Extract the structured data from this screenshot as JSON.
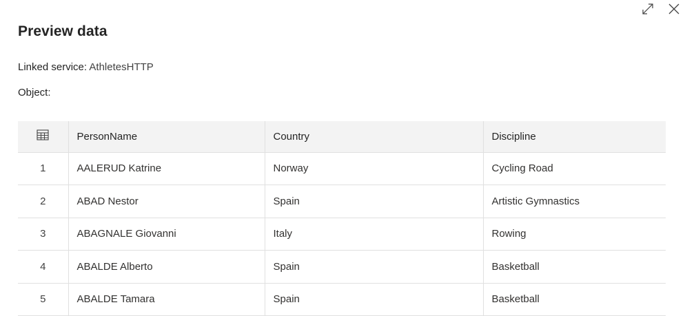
{
  "dialog": {
    "title": "Preview data",
    "linked_service_label": "Linked service:",
    "linked_service_value": "AthletesHTTP",
    "object_label": "Object:",
    "object_value": ""
  },
  "icons": {
    "expand": "expand-icon",
    "close": "close-icon",
    "grid": "table-grid-icon"
  },
  "table": {
    "columns": [
      "PersonName",
      "Country",
      "Discipline"
    ],
    "rows": [
      {
        "index": "1",
        "person": "AALERUD Katrine",
        "country": "Norway",
        "discipline": "Cycling Road"
      },
      {
        "index": "2",
        "person": "ABAD Nestor",
        "country": "Spain",
        "discipline": "Artistic Gymnastics"
      },
      {
        "index": "3",
        "person": "ABAGNALE Giovanni",
        "country": "Italy",
        "discipline": "Rowing"
      },
      {
        "index": "4",
        "person": "ABALDE Alberto",
        "country": "Spain",
        "discipline": "Basketball"
      },
      {
        "index": "5",
        "person": "ABALDE Tamara",
        "country": "Spain",
        "discipline": "Basketball"
      }
    ]
  }
}
